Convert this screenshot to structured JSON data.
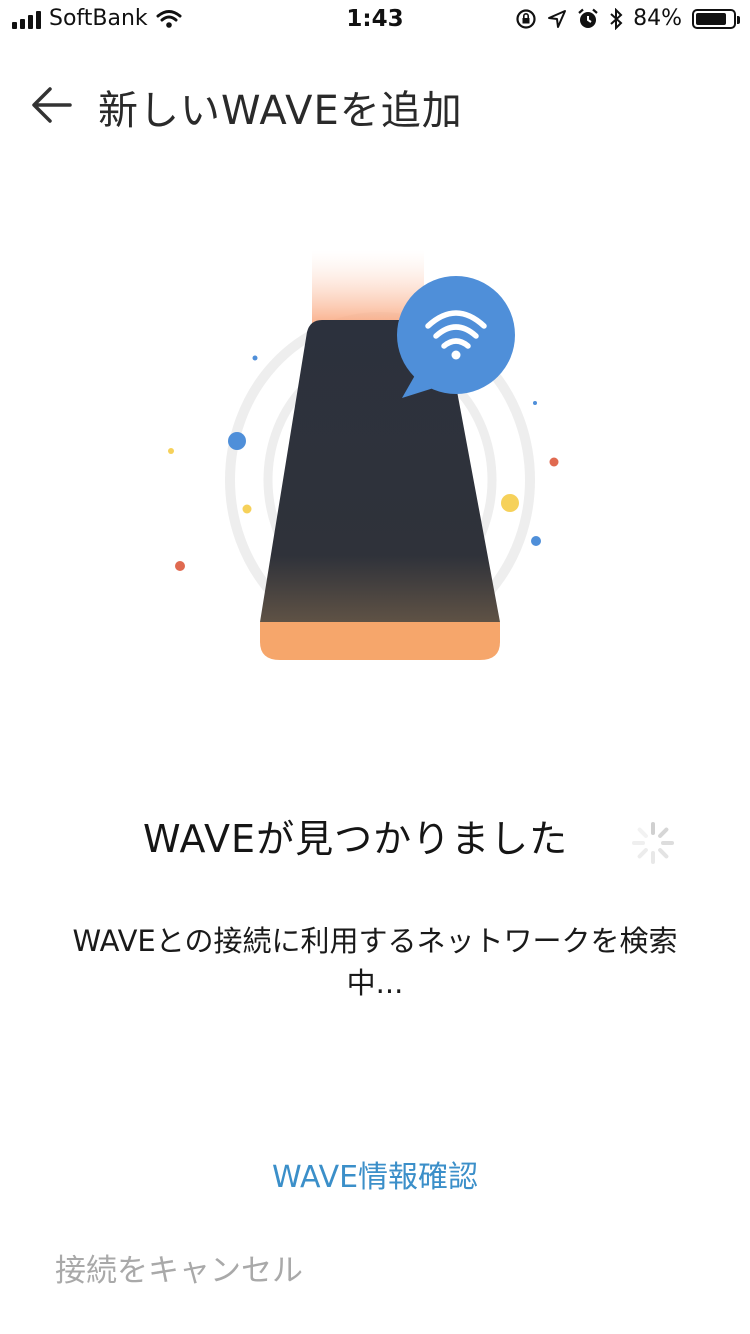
{
  "status_bar": {
    "carrier": "SoftBank",
    "time": "1:43",
    "battery_percent": "84%",
    "battery_level": 0.84,
    "icons": [
      "signal-bars-icon",
      "wifi-icon",
      "rotation-lock-icon",
      "location-arrow-icon",
      "alarm-icon",
      "bluetooth-icon",
      "battery-icon"
    ]
  },
  "header": {
    "back_icon": "arrow-left-icon",
    "title": "新しいWAVEを追加"
  },
  "illustration": {
    "device_color": "#2b303b",
    "base_color": "#f6a66b",
    "bubble_color": "#4f8fd9",
    "bubble_icon": "wifi-icon"
  },
  "main": {
    "found_title": "WAVEが見つかりました",
    "search_message": "WAVEとの接続に利用するネットワークを検索中..."
  },
  "actions": {
    "wave_info_label": "WAVE情報確認",
    "cancel_label": "接続をキャンセル"
  },
  "colors": {
    "link": "#3b8fc9",
    "muted": "#a9a9a9"
  }
}
